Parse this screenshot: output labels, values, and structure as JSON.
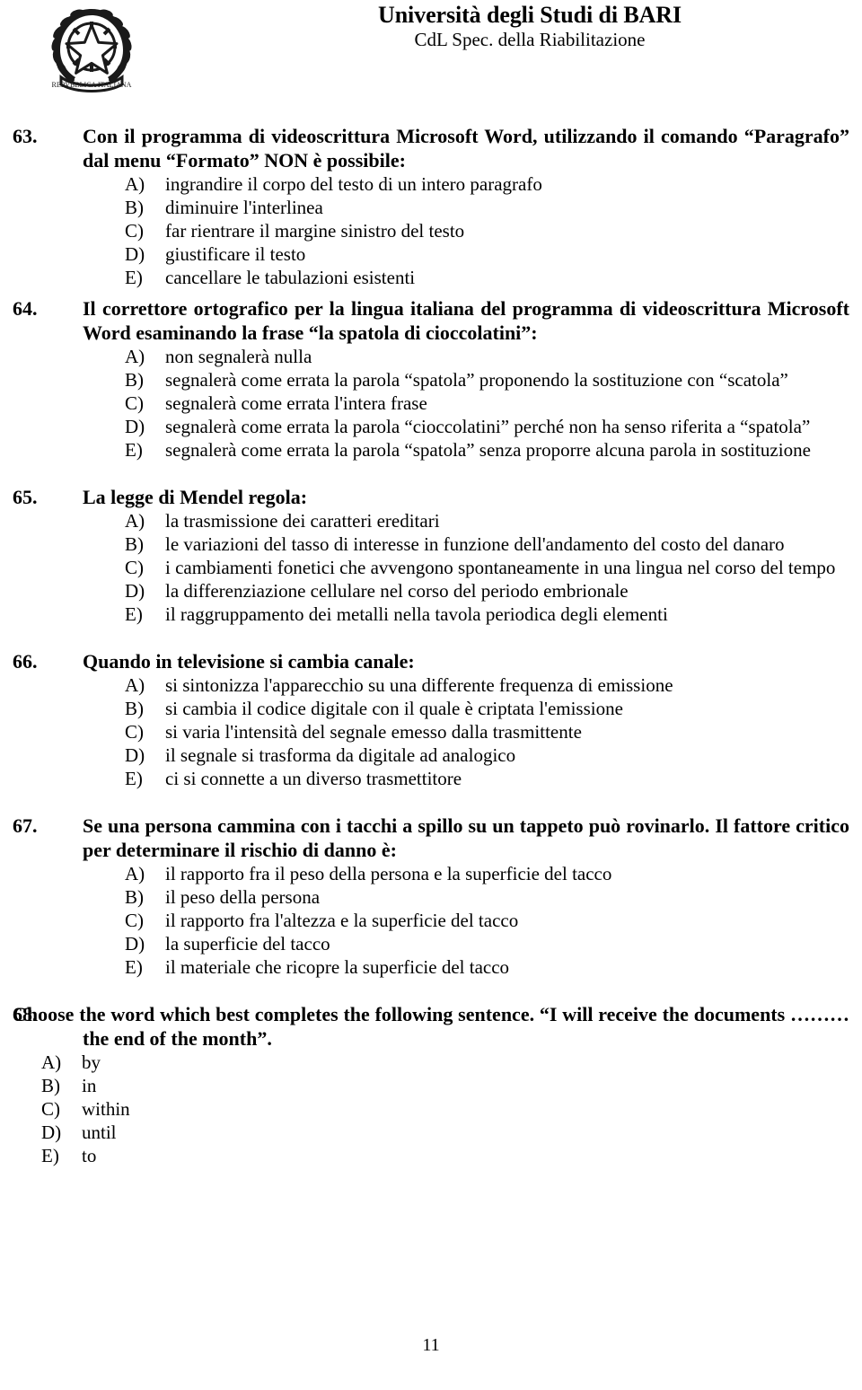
{
  "header": {
    "emblem_icon": "italian-republic-emblem-icon",
    "university": "Università degli Studi di BARI",
    "course": "CdL Spec. della Riabilitazione"
  },
  "footer": {
    "page_number": "11"
  },
  "questions": [
    {
      "number": "63.",
      "stem": "Con il programma di videoscrittura Microsoft Word, utilizzando il comando “Paragrafo” dal menu “Formato” NON è possibile:",
      "options": [
        {
          "letter": "A)",
          "text": "ingrandire il corpo del testo di un intero paragrafo"
        },
        {
          "letter": "B)",
          "text": "diminuire l'interlinea"
        },
        {
          "letter": "C)",
          "text": "far rientrare il margine sinistro del testo"
        },
        {
          "letter": "D)",
          "text": "giustificare il testo"
        },
        {
          "letter": "E)",
          "text": "cancellare le tabulazioni esistenti"
        }
      ]
    },
    {
      "number": "64.",
      "stem": "Il correttore ortografico per la lingua italiana del programma di videoscrittura Microsoft Word esaminando la frase “la spatola di cioccolatini”:",
      "options": [
        {
          "letter": "A)",
          "text": "non segnalerà nulla"
        },
        {
          "letter": "B)",
          "text": "segnalerà come errata la parola “spatola” proponendo la sostituzione con “scatola”"
        },
        {
          "letter": "C)",
          "text": "segnalerà come errata l'intera frase"
        },
        {
          "letter": "D)",
          "text": "segnalerà come errata la parola “cioccolatini” perché non ha senso riferita a “spatola”"
        },
        {
          "letter": "E)",
          "text": "segnalerà come errata la parola “spatola” senza proporre alcuna parola in sostituzione"
        }
      ]
    },
    {
      "number": "65.",
      "stem": "La legge di Mendel regola:",
      "options": [
        {
          "letter": "A)",
          "text": "la trasmissione dei caratteri ereditari"
        },
        {
          "letter": "B)",
          "text": "le variazioni del tasso di interesse in funzione dell'andamento del costo del danaro"
        },
        {
          "letter": "C)",
          "text": "i cambiamenti fonetici che avvengono spontaneamente in una lingua nel corso del tempo"
        },
        {
          "letter": "D)",
          "text": "la differenziazione cellulare nel corso del periodo embrionale"
        },
        {
          "letter": "E)",
          "text": "il raggruppamento dei metalli nella tavola periodica degli elementi"
        }
      ]
    },
    {
      "number": "66.",
      "stem": "Quando in televisione si cambia canale:",
      "options": [
        {
          "letter": "A)",
          "text": "si sintonizza l'apparecchio su una differente frequenza di emissione"
        },
        {
          "letter": "B)",
          "text": "si cambia il codice digitale con il quale è criptata l'emissione"
        },
        {
          "letter": "C)",
          "text": "si varia l'intensità del segnale emesso dalla trasmittente"
        },
        {
          "letter": "D)",
          "text": "il segnale si trasforma da digitale ad analogico"
        },
        {
          "letter": "E)",
          "text": "ci si connette a un diverso trasmettitore"
        }
      ]
    },
    {
      "number": "67.",
      "stem": "Se una persona cammina con i tacchi a spillo su un tappeto può rovinarlo. Il fattore critico per determinare il rischio di danno è:",
      "options": [
        {
          "letter": "A)",
          "text": "il rapporto fra il peso della persona e la superficie del tacco"
        },
        {
          "letter": "B)",
          "text": "il peso della persona"
        },
        {
          "letter": "C)",
          "text": "il rapporto fra l'altezza e la superficie del tacco"
        },
        {
          "letter": "D)",
          "text": "la superficie del tacco"
        },
        {
          "letter": "E)",
          "text": "il materiale che ricopre la superficie del tacco"
        }
      ]
    },
    {
      "number": "68.",
      "stem": "Choose the word which best completes the following sentence. “I will receive the documents ……… the end of the month”.",
      "options": [
        {
          "letter": "A)",
          "text": "by"
        },
        {
          "letter": "B)",
          "text": "in"
        },
        {
          "letter": "C)",
          "text": "within"
        },
        {
          "letter": "D)",
          "text": "until"
        },
        {
          "letter": "E)",
          "text": "to"
        }
      ]
    }
  ]
}
